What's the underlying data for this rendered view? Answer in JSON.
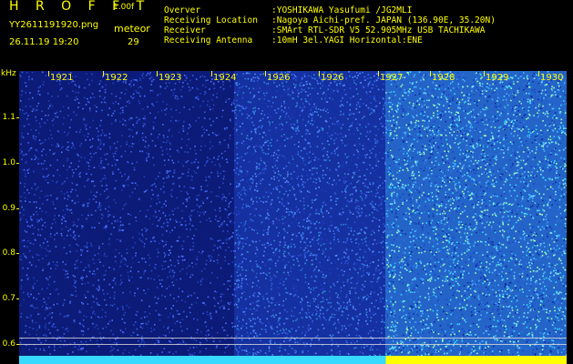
{
  "header": {
    "title": "H R O F F T",
    "version": "1.00f",
    "filename": "YY2611191920.png",
    "timestamp": "26.11.19 19:20",
    "meteor_label": "meteor",
    "meteor_count": "29"
  },
  "info": [
    {
      "key": "Overver",
      "value": ":YOSHIKAWA Yasufumi /JG2MLI"
    },
    {
      "key": "Receiving Location",
      "value": ":Nagoya Aichi-pref. JAPAN (136.90E, 35.20N)"
    },
    {
      "key": "Receiver",
      "value": ":SMArt RTL-SDR V5 52.905MHz USB TACHIKAWA"
    },
    {
      "key": "Receiving Antenna",
      "value": ":10mH 3el.YAGI Horizontal:ENE"
    }
  ],
  "axis": {
    "y_unit": "kHz",
    "y_labels": [
      "1.1",
      "1.0",
      "0.9",
      "0.8",
      "0.7",
      "0.6"
    ],
    "minute_labels": [
      "1921",
      "1922",
      "1923",
      "1924",
      "1926",
      "1926",
      "1927",
      "1928",
      "1929",
      "1930"
    ]
  },
  "colors": {
    "text": "#ffff00",
    "background": "#000000",
    "dark_blue": "#0a1a66",
    "medium_blue": "#1d3bb0",
    "cyan": "#36d9ff"
  }
}
